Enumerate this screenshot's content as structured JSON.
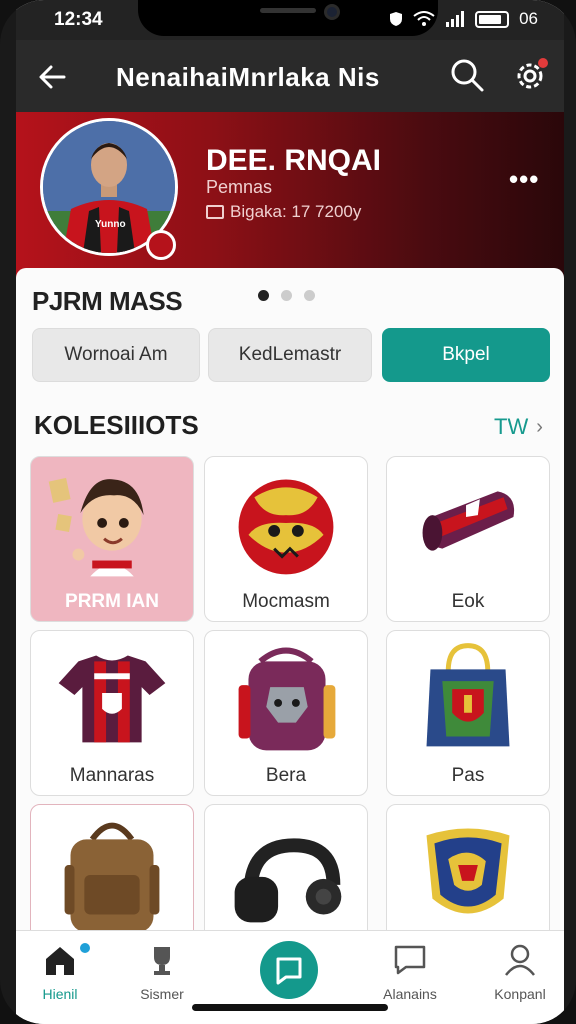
{
  "status_bar": {
    "time": "12:34",
    "battery_text": "06"
  },
  "app_bar": {
    "title": "NenaihaiMnrlaka Nis"
  },
  "profile": {
    "name": "DEE. RNQAI",
    "role": "Pemnas",
    "meta": "Bigaka: 17 7200y"
  },
  "section": {
    "title": "PJRM MASS",
    "segments": [
      "Wornoai Am",
      "KedLemastr",
      "Bkpel"
    ],
    "active_segment": 2
  },
  "collections": {
    "title": "KOLESIIIOTS",
    "more_label": "TW",
    "items": [
      {
        "label": "PRRM IAN",
        "icon": "cartoon-avatar-icon"
      },
      {
        "label": "Mocmasm",
        "icon": "football-icon"
      },
      {
        "label": "Eok",
        "icon": "scarf-icon"
      },
      {
        "label": "Mannaras",
        "icon": "jersey-icon"
      },
      {
        "label": "Bera",
        "icon": "backpack-icon"
      },
      {
        "label": "Pas",
        "icon": "tote-bag-icon"
      },
      {
        "label": "",
        "icon": "leather-bag-icon"
      },
      {
        "label": "",
        "icon": "headphones-icon"
      },
      {
        "label": "",
        "icon": "shield-badge-icon"
      }
    ]
  },
  "bottom_nav": {
    "items": [
      {
        "label": "Hienil",
        "icon": "home-icon"
      },
      {
        "label": "Sismer",
        "icon": "trophy-icon"
      },
      {
        "label": "",
        "icon": "chat-icon"
      },
      {
        "label": "Alanains",
        "icon": "message-icon"
      },
      {
        "label": "Konpanl",
        "icon": "profile-icon"
      }
    ]
  },
  "colors": {
    "accent": "#14998c",
    "brand_red": "#b5121b",
    "dark": "#2a2a2a"
  }
}
